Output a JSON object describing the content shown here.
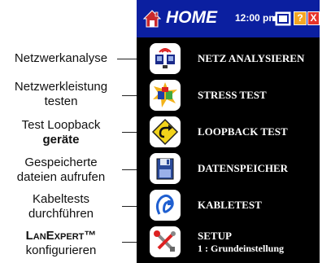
{
  "titlebar": {
    "title": "HOME",
    "time": "12:00 pm",
    "help_label": "?",
    "close_label": "X",
    "icons": {
      "home": "home-icon",
      "battery": "battery-icon",
      "help": "help-icon",
      "close": "close-icon"
    }
  },
  "menu": {
    "items": [
      {
        "label": "NETZ ANALYSIEREN",
        "icon": "network-analysis-icon"
      },
      {
        "label": "STRESS TEST",
        "icon": "stress-test-icon"
      },
      {
        "label": "LOOPBACK TEST",
        "icon": "loopback-icon"
      },
      {
        "label": "DATENSPEICHER",
        "icon": "data-storage-icon"
      },
      {
        "label": "KABLETEST",
        "icon": "cable-test-icon"
      },
      {
        "label": "SETUP",
        "sublabel": "1 : Grundeinstellung",
        "icon": "setup-tools-icon"
      }
    ]
  },
  "callouts": [
    {
      "line1": "Netzwerkanalyse"
    },
    {
      "line1": "Netzwerkleistung",
      "line2": "testen"
    },
    {
      "line1": "Test Loopback",
      "line2": "geräte"
    },
    {
      "line1": "Gespeicherte",
      "line2": "dateien aufrufen"
    },
    {
      "line1": "Kabeltests",
      "line2": "durchführen"
    },
    {
      "line1": "LanExpert™",
      "line2": "konfigurieren"
    }
  ],
  "colors": {
    "titlebar_bg": "#0b1fa0",
    "screen_bg": "#000000",
    "help_button": "#f5a623",
    "close_button": "#e8342b",
    "icon_tile": "#ffffff"
  }
}
